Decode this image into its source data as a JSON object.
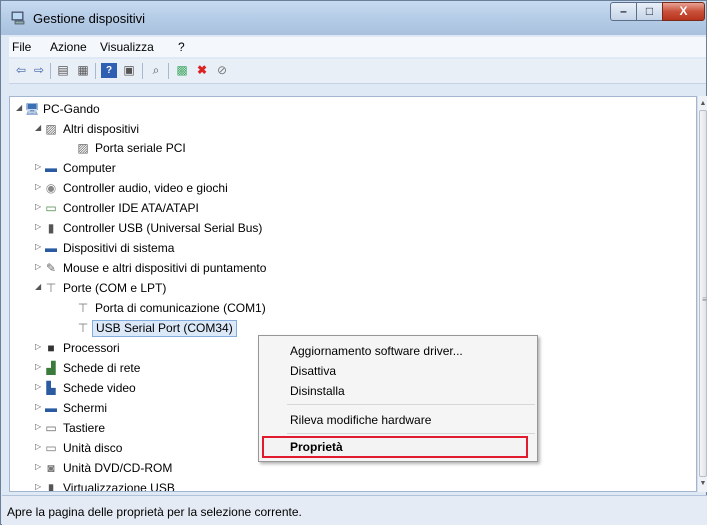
{
  "window": {
    "title": "Gestione dispositivi",
    "controls": {
      "minimize": "–",
      "maximize": "□",
      "close": "X"
    }
  },
  "menu": [
    "File",
    "Azione",
    "Visualizza",
    "?"
  ],
  "toolbar_icons": [
    "back-arrow-icon",
    "forward-arrow-icon",
    "device-view-icon",
    "list-view-icon",
    "help-icon",
    "properties-icon",
    "scan-hardware-icon",
    "update-driver-icon",
    "uninstall-icon",
    "disable-device-icon"
  ],
  "tree": {
    "root": "PC-Gando",
    "items": [
      {
        "label": "Altri dispositivi",
        "expanded": true
      },
      {
        "label": "Porta seriale PCI"
      },
      {
        "label": "Computer"
      },
      {
        "label": "Controller audio, video e giochi"
      },
      {
        "label": "Controller IDE ATA/ATAPI"
      },
      {
        "label": "Controller USB (Universal Serial Bus)"
      },
      {
        "label": "Dispositivi di sistema"
      },
      {
        "label": "Mouse e altri dispositivi di puntamento"
      },
      {
        "label": "Porte (COM e LPT)",
        "expanded": true
      },
      {
        "label": "Porta di comunicazione (COM1)"
      },
      {
        "label": "USB Serial Port (COM34)",
        "selected": true
      },
      {
        "label": "Processori"
      },
      {
        "label": "Schede di rete"
      },
      {
        "label": "Schede video"
      },
      {
        "label": "Schermi"
      },
      {
        "label": "Tastiere"
      },
      {
        "label": "Unità disco"
      },
      {
        "label": "Unità DVD/CD-ROM"
      },
      {
        "label": "Virtualizzazione USB"
      }
    ]
  },
  "context_menu": {
    "items": [
      "Aggiornamento software driver...",
      "Disattiva",
      "Disinstalla",
      "Rileva modifiche hardware",
      "Proprietà"
    ],
    "highlighted": "Proprietà",
    "highlight_color": "#e11a2d"
  },
  "status_bar": "Apre la pagina delle proprietà per la selezione corrente."
}
